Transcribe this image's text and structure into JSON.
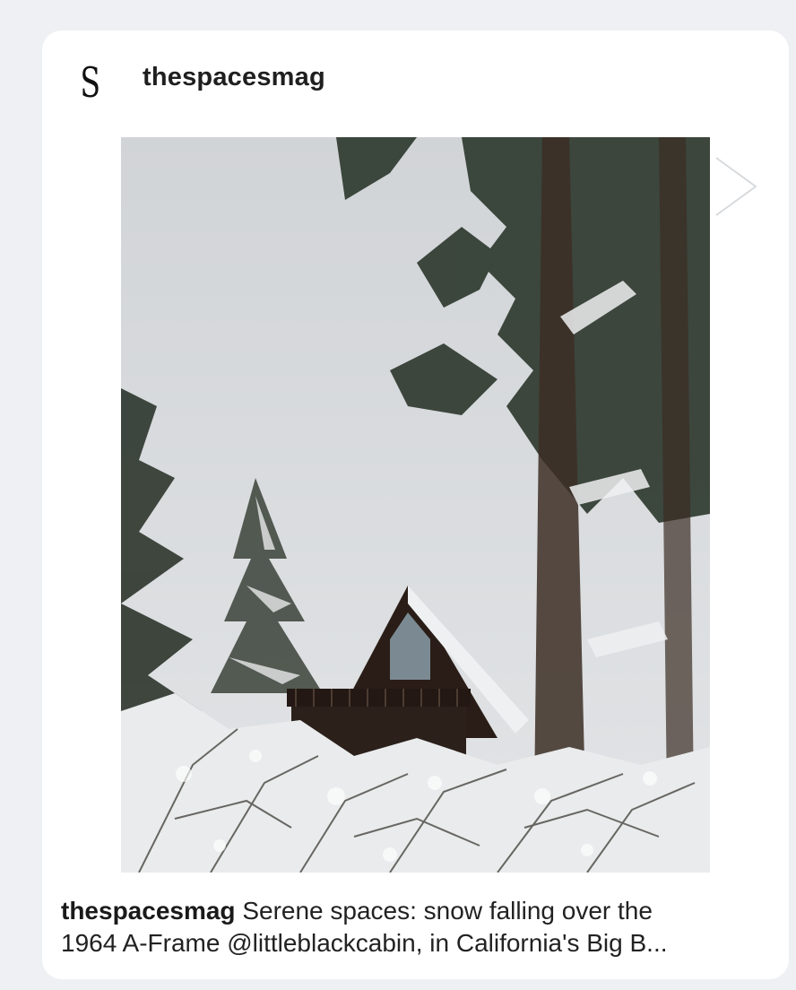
{
  "post": {
    "avatar_letter": "S",
    "username": "thespacesmag",
    "caption_user": "thespacesmag",
    "caption_line1": "Serene spaces: snow falling over the",
    "caption_line2": "1964 A-Frame @littleblackcabin, in California's Big B..."
  },
  "icons": {
    "next": "chevron-right-icon"
  },
  "colors": {
    "page_background": "#eef0f3",
    "card_background": "#ffffff",
    "text": "#222222",
    "cabin": "#2a1d17",
    "sky": "#d7dadd"
  }
}
